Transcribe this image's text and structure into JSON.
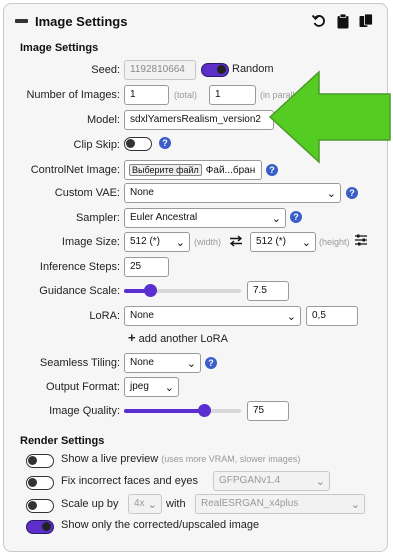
{
  "header": {
    "title": "Image Settings",
    "icons": [
      "reset-icon",
      "clipboard-icon",
      "copy-icon"
    ]
  },
  "image_settings": {
    "section_title": "Image Settings",
    "seed": {
      "label": "Seed:",
      "value": "1192810664",
      "random_label": "Random",
      "random_on": true
    },
    "num_images": {
      "label": "Number of Images:",
      "total_value": "1",
      "total_hint": "(total)",
      "parallel_value": "1",
      "parallel_hint": "(in parallel)"
    },
    "model": {
      "label": "Model:",
      "value": "sdxlYamersRealism_version2"
    },
    "clip_skip": {
      "label": "Clip Skip:",
      "on": false
    },
    "controlnet": {
      "label": "ControlNet Image:",
      "button": "Выберите файл",
      "file_text": "Фай...бран"
    },
    "custom_vae": {
      "label": "Custom VAE:",
      "value": "None"
    },
    "sampler": {
      "label": "Sampler:",
      "value": "Euler Ancestral"
    },
    "image_size": {
      "label": "Image Size:",
      "width": "512 (*)",
      "width_hint": "(width)",
      "height": "512 (*)",
      "height_hint": "(height)"
    },
    "steps": {
      "label": "Inference Steps:",
      "value": "25"
    },
    "guidance": {
      "label": "Guidance Scale:",
      "value": "7.5",
      "fraction": 0.19
    },
    "lora": {
      "label": "LoRA:",
      "value": "None",
      "weight": "0,5",
      "add_label": "add another LoRA"
    },
    "seamless": {
      "label": "Seamless Tiling:",
      "value": "None"
    },
    "output_format": {
      "label": "Output Format:",
      "value": "jpeg"
    },
    "quality": {
      "label": "Image Quality:",
      "value": "75",
      "fraction": 0.71
    }
  },
  "render_settings": {
    "section_title": "Render Settings",
    "live_preview": {
      "label": "Show a live preview",
      "hint": "(uses more VRAM, slower images)",
      "on": false
    },
    "fix_faces": {
      "label": "Fix incorrect faces and eyes",
      "model": "GFPGANv1.4",
      "on": false
    },
    "upscale": {
      "label": "Scale up by",
      "factor": "4x",
      "with_label": "with",
      "model": "RealESRGAN_x4plus",
      "on": false
    },
    "show_only_corrected": {
      "label": "Show only the corrected/upscaled image",
      "on": true
    }
  },
  "colors": {
    "accent": "#5a2ed0",
    "help": "#3a5ec8",
    "arrow": "#55cc22"
  }
}
